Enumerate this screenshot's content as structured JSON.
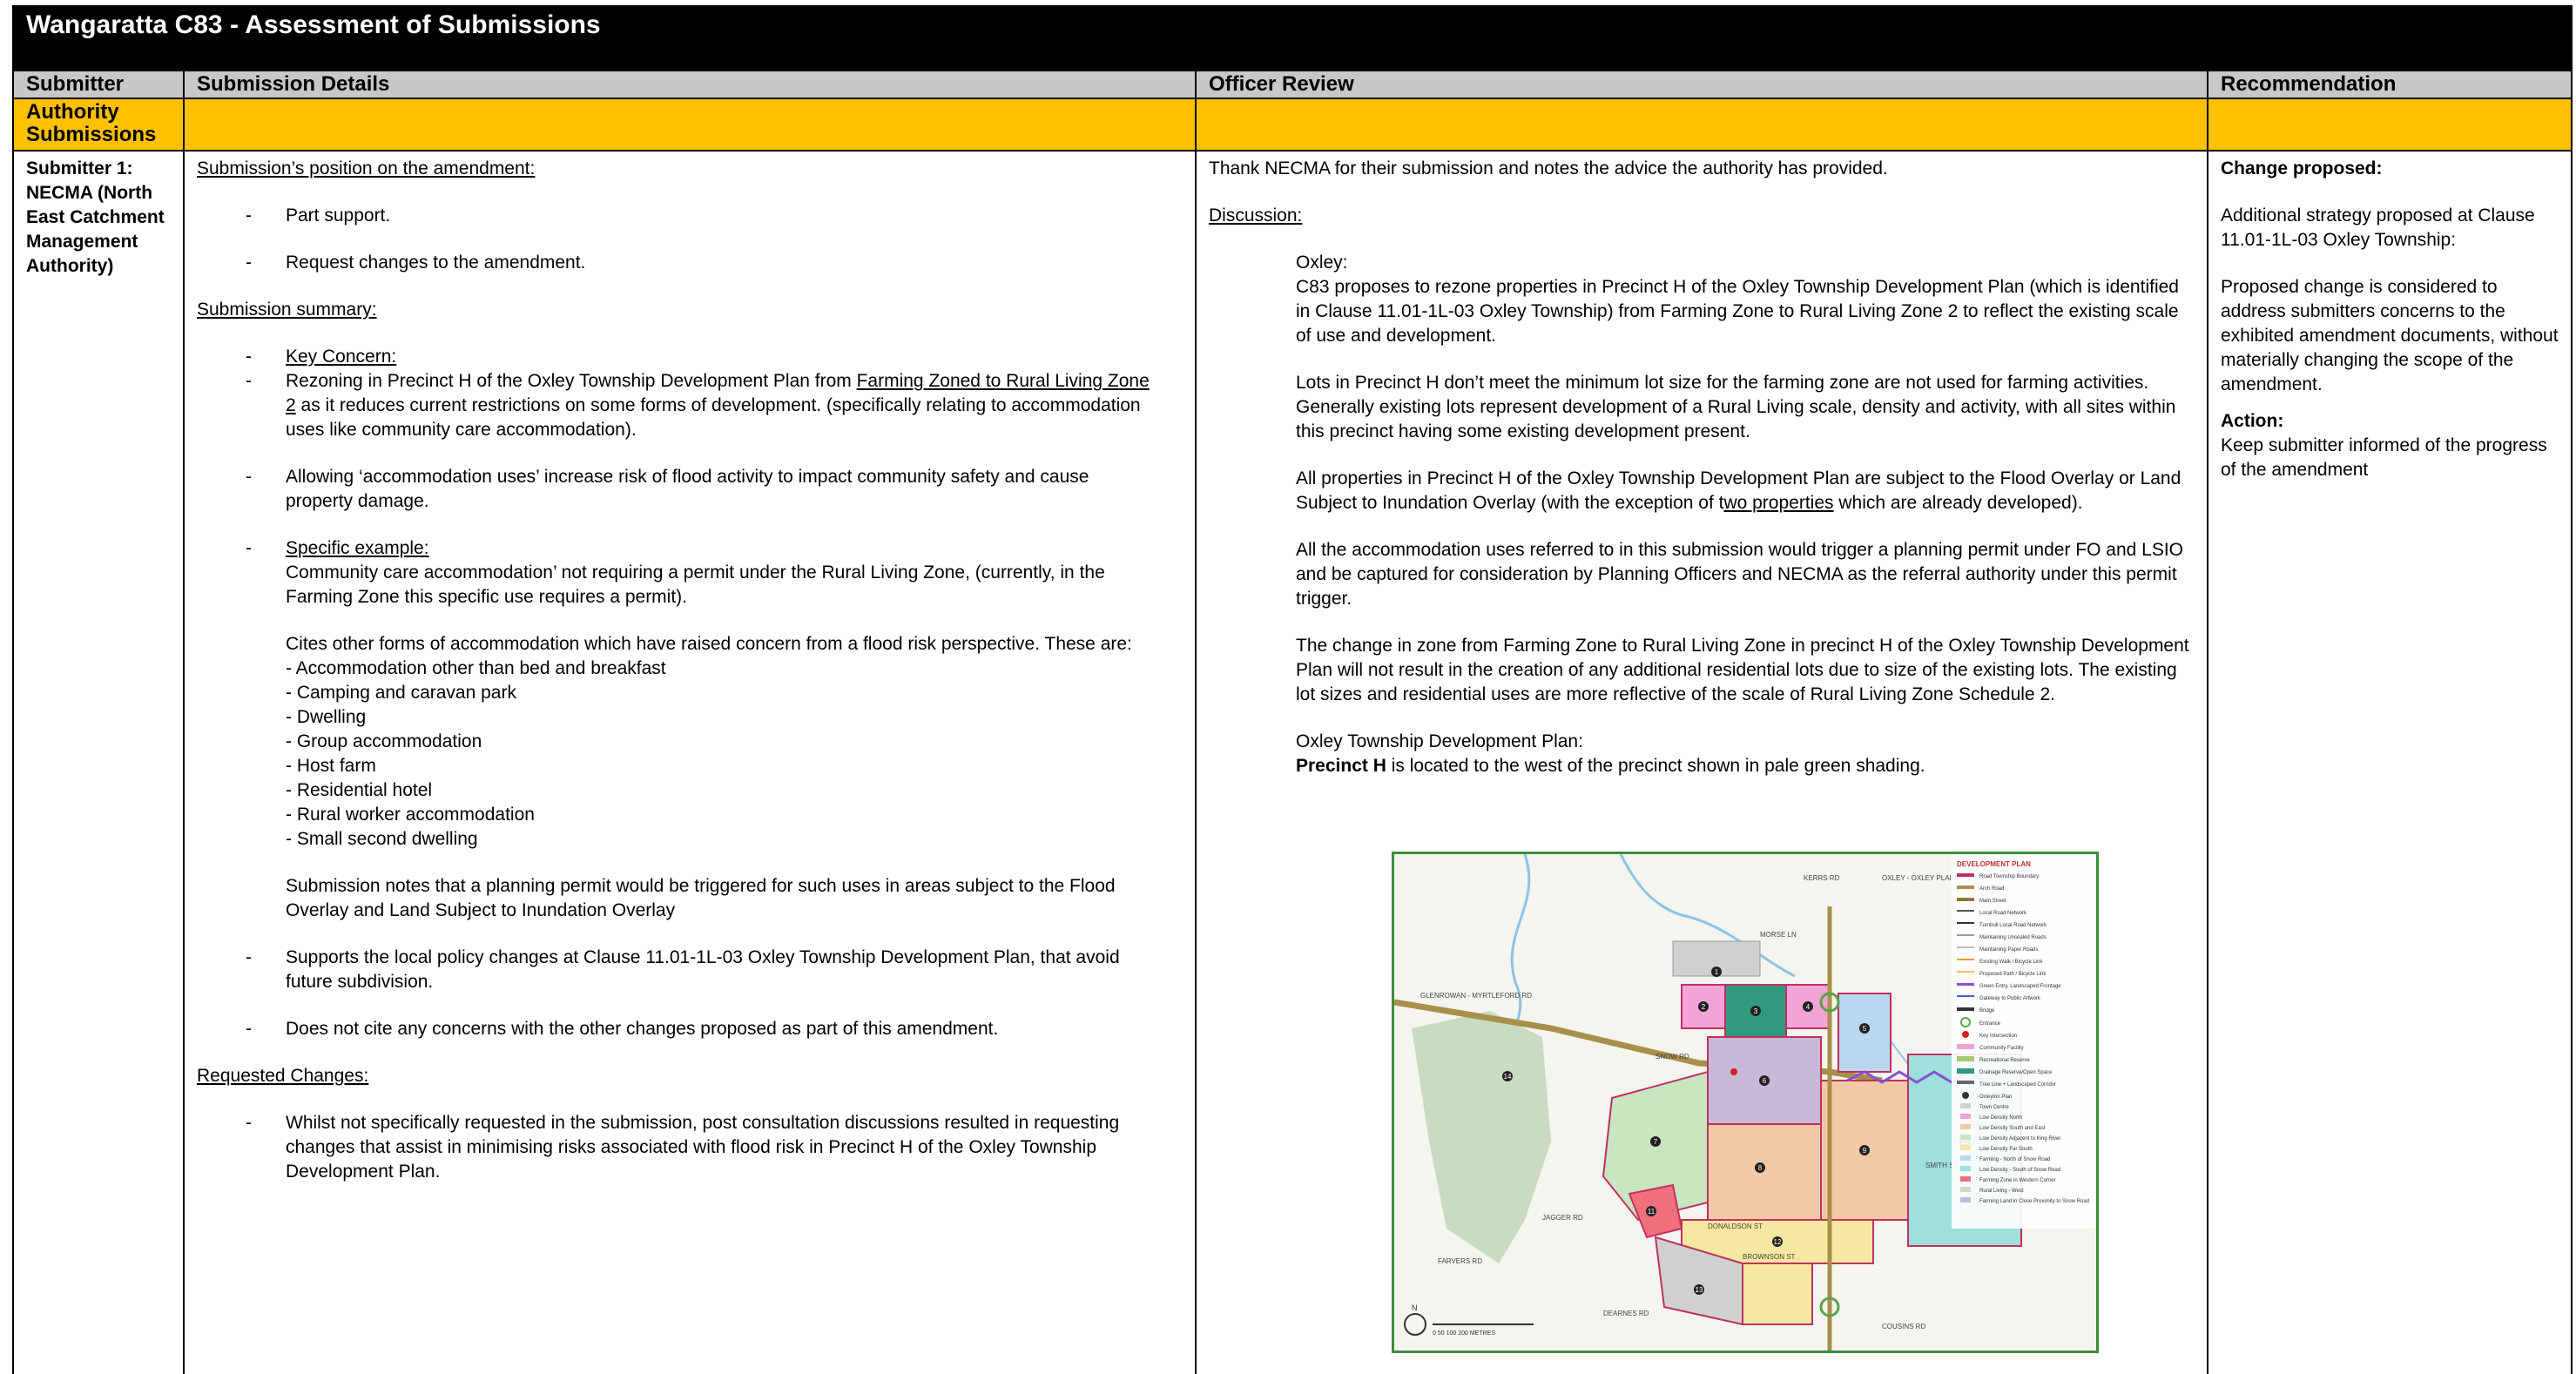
{
  "title": "Wangaratta C83 -  Assessment of Submissions",
  "headers": {
    "submitter": "Submitter",
    "details": "Submission Details",
    "review": "Officer Review",
    "recommendation": "Recommendation"
  },
  "category": "Authority Submissions",
  "submitter": "Submitter 1: NECMA (North East Catchment Management Authority)",
  "details": {
    "position_heading": "Submission’s position on the amendment:",
    "position_items": [
      "Part support.",
      "Request changes to the amendment."
    ],
    "summary_heading": "Submission summary:",
    "key_concern_label": "Key Concern:",
    "key_concern_pre": "Rezoning in Precinct H of the Oxley Township Development Plan from ",
    "key_concern_link": "Farming Zoned to Rural Living Zone 2",
    "key_concern_post": " as it reduces current restrictions on some forms of development. (specifically relating to accommodation uses like community care accommodation).",
    "allowing": "Allowing ‘accommodation uses’ increase risk of flood activity to impact community safety and cause property damage.",
    "specific_label": "Specific example:",
    "specific_text": "Community care accommodation’ not requiring a permit under the Rural Living Zone, (currently, in the Farming Zone this specific use requires a permit).",
    "cites": "Cites other forms of accommodation which have raised concern from a flood risk perspective. These are:",
    "uses": [
      "- Accommodation other than bed and breakfast",
      "- Camping and caravan park",
      "- Dwelling",
      "- Group accommodation",
      "- Host farm",
      "- Residential hotel",
      "- Rural worker accommodation",
      "- Small second dwelling"
    ],
    "notes": "Submission notes that a planning permit would be triggered for such uses in areas subject to the Flood Overlay and Land Subject to Inundation Overlay",
    "supports": "Supports the local policy changes at Clause 11.01-1L-03 Oxley Township Development Plan, that avoid future subdivision.",
    "no_concerns": "Does not cite any concerns with the other changes proposed as part of this amendment.",
    "requested_heading": "Requested Changes:",
    "requested_item": "Whilst not specifically requested in the submission, post consultation discussions resulted in requesting changes that assist in minimising risks associated with flood risk in Precinct H of the Oxley Township Development Plan."
  },
  "review": {
    "intro": "Thank NECMA for their submission and notes the advice the authority has provided.",
    "discussion_heading": "Discussion:",
    "oxley_label": "Oxley:",
    "oxley_text": "C83 proposes to rezone properties in Precinct H of the Oxley Township Development Plan (which is identified in Clause 11.01-1L-03 Oxley Township) from Farming Zone to Rural Living Zone 2 to reflect the existing scale of use and development.",
    "lots_text": "Lots in Precinct H don’t meet the minimum lot size for the farming zone are not used for farming activities. Generally existing lots represent development of a Rural Living scale, density and activity, with all sites within this precinct having some existing development present.",
    "overlay_pre": "All properties in Precinct H of the Oxley Township Development Plan are subject to the Flood Overlay or Land Subject to Inundation Overlay (with the exception of t",
    "overlay_link": "wo properties",
    "overlay_post": " which are already developed).",
    "permit_text": "All the accommodation uses referred to in this submission would trigger a planning permit under FO and LSIO and be captured for consideration by Planning Officers and NECMA as the referral authority under this permit trigger.",
    "zone_text": "The change in zone from Farming Zone to Rural Living Zone in precinct H of the Oxley Township Development Plan will not result in the creation of any additional residential lots due to size of the existing lots. The existing lot sizes and residential uses are more reflective of the scale of Rural Living Zone Schedule 2.",
    "plan_label": "Oxley Township Development Plan:",
    "precinct_bold": "Precinct H",
    "precinct_rest": " is located to the west of the precinct shown in pale green shading."
  },
  "map": {
    "legend_title": "DEVELOPMENT PLAN",
    "road_labels": [
      "MORSE LN",
      "SNOW RD",
      "DONALDSON ST",
      "SMITH ST",
      "DEARNES RD",
      "BROWNSON ST",
      "COUSINS RD",
      "KERRS RD",
      "OXLEY - OXLEY PLAINS RD",
      "GLENROWAN - MYRTLEFORD RD",
      "FARVERS RD",
      "JAGGER RD"
    ],
    "numbers": [
      "1",
      "2",
      "3",
      "4",
      "5",
      "6",
      "7",
      "8",
      "9",
      "10",
      "11",
      "12",
      "13",
      "14"
    ],
    "scale_label": "0 50 100 200 METRES",
    "north": "N",
    "colors": {
      "precinct_h": "#c8e6c0",
      "residential": "#f2c9a6",
      "low_density": "#f6e8a0",
      "commercial": "#c9b8d8",
      "rural_living": "#9ee0dc",
      "farming": "#b9d8f0",
      "open_space": "#d0d0d0",
      "pink": "#f2a4b8"
    },
    "legend": [
      "Road Township Boundary",
      "Arch Road",
      "Main Street",
      "Local Road Network",
      "Turnbull Local Road Network",
      "Maintaining Unsealed Roads",
      "Maintaining Paper Roads",
      "Existing Walk / Bicycle Link",
      "Proposed Path / Bicycle Link",
      "Green Entry, Landscaped Frontage",
      "Gateway to Public Artwork",
      "Bridge",
      "Entrance",
      "Key Intersection",
      "Community Facility",
      "Recreational Reserve",
      "Drainage Reserve/Open Space",
      "Tree Line + Landscaped Corridor",
      "Oxleyton Plan",
      "Town Centre",
      "Low Density North",
      "Low Density South and East",
      "Low Density Adjacent to King River",
      "Low Density Far South",
      "Farming - North of Snow Road",
      "Low Density - South of Snow Road",
      "Farming Zone in Western Corner",
      "Rural Living - West",
      "Farming Land in Close Proximity to Snow Road"
    ]
  },
  "recommendation": {
    "change_heading": "Change proposed:",
    "additional": "Additional strategy proposed at Clause 11.01-1L-03 Oxley Township:",
    "considered": "Proposed change is considered to address submitters concerns to the exhibited amendment documents, without materially changing the scope of the amendment.",
    "action_heading": "Action:",
    "action_text": "Keep submitter informed of the progress of the amendment"
  }
}
